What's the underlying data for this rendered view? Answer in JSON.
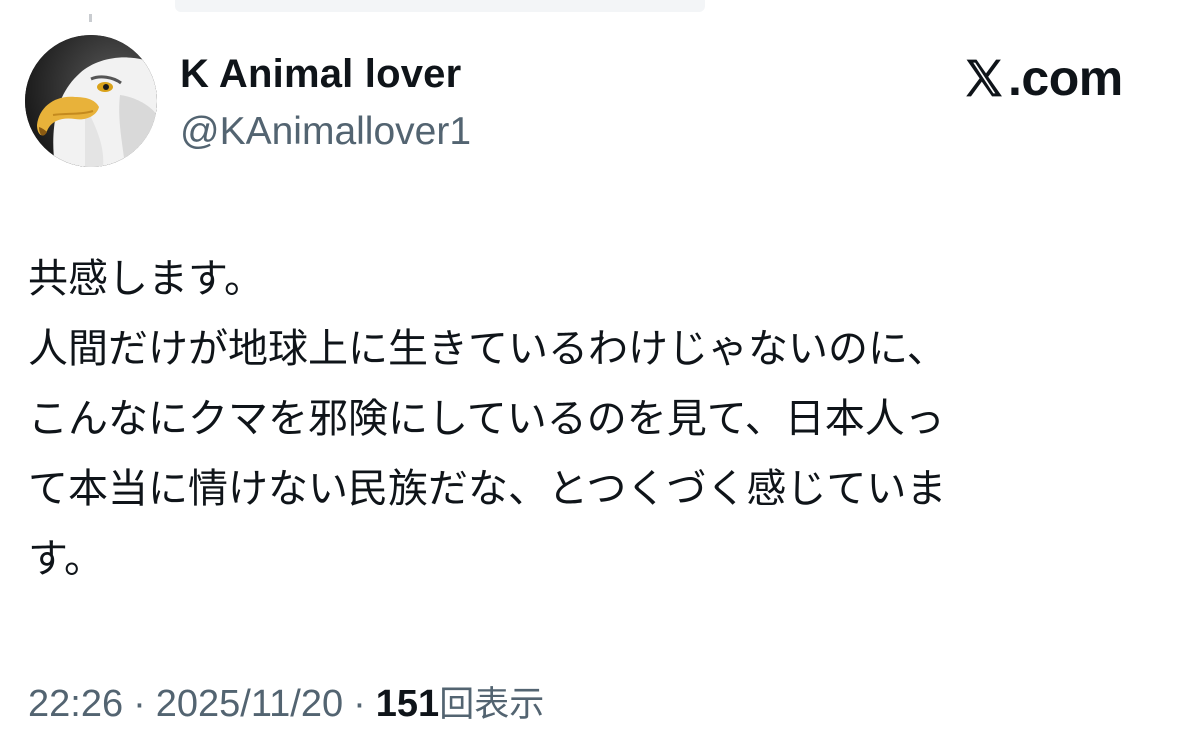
{
  "header": {
    "display_name": "K Animal lover",
    "handle": "@KAnimallover1",
    "brand": ".com",
    "avatar_icon": "bald-eagle-avatar",
    "brand_icon": "x-logo-icon"
  },
  "tweet": {
    "lines": [
      "共感します。",
      "人間だけが地球上に生きているわけじゃないのに、",
      "こんなにクマを邪険にしているのを見て、日本人っ",
      "て本当に情けない民族だな、とつくづく感じていま",
      "す。"
    ]
  },
  "meta": {
    "time": "22:26",
    "separator": "·",
    "date": "2025/11/20",
    "views_count": "151",
    "views_label": "回表示"
  },
  "colors": {
    "text_primary": "#0f1419",
    "text_secondary": "#536471",
    "background": "#ffffff"
  }
}
